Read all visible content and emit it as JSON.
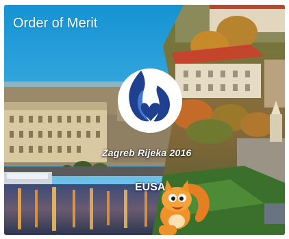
{
  "card": {
    "title": "Order of Merit",
    "event_name": "Zagreb Rijeka 2016",
    "org_name": "EUSA"
  },
  "icons": {
    "logo": "flame-heart-logo",
    "mascot": "squirrel-mascot"
  },
  "colors": {
    "sky": "#1e9fd6",
    "logo_dark": "#1f3f8f",
    "logo_light": "#ffffff",
    "mascot_orange": "#f0912a",
    "grass": "#3b6f2c"
  }
}
